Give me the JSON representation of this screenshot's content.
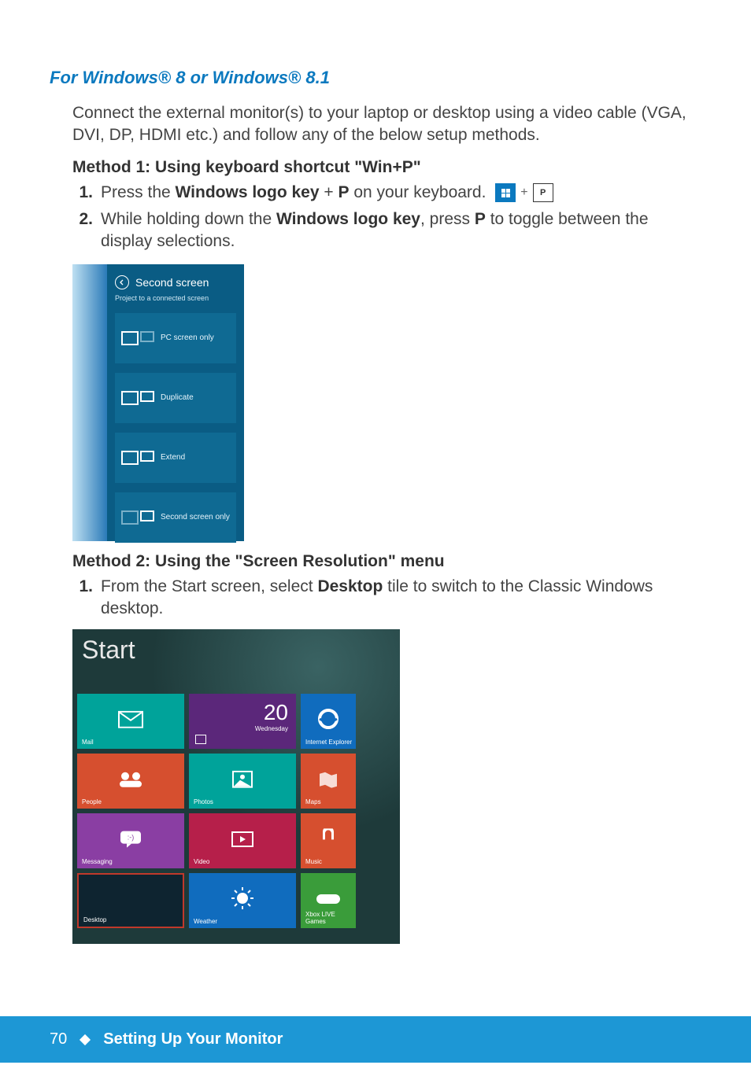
{
  "heading": "For Windows® 8 or Windows® 8.1",
  "intro": "Connect the external monitor(s) to your laptop or desktop using a video cable (VGA, DVI, DP, HDMI etc.) and follow any of the below setup methods.",
  "method1_title": "Method 1: Using keyboard shortcut \"Win+P\"",
  "step1_pre": "Press the ",
  "step1_bold1": "Windows logo key",
  "step1_mid": " + ",
  "step1_bold2": "P",
  "step1_post": " on your keyboard.",
  "step2_pre": "While holding down the ",
  "step2_bold1": "Windows logo key",
  "step2_mid": ", press ",
  "step2_bold2": "P",
  "step2_post": " to toggle between the display selections.",
  "charm": {
    "title": "Second screen",
    "subtitle": "Project to a connected screen",
    "options": [
      "PC screen only",
      "Duplicate",
      "Extend",
      "Second screen only"
    ]
  },
  "method2_title": "Method 2: Using the \"Screen Resolution\" menu",
  "m2_step1_pre": "From the Start screen, select ",
  "m2_step1_bold": "Desktop",
  "m2_step1_post": " tile to switch to the Classic Windows desktop.",
  "start": {
    "title": "Start",
    "tiles": {
      "mail": "Mail",
      "cal_num": "20",
      "cal_day": "Wednesday",
      "ie": "Internet Explorer",
      "people": "People",
      "photos": "Photos",
      "maps": "Maps",
      "messaging": "Messaging",
      "video": "Video",
      "music": "Music",
      "desktop": "Desktop",
      "weather": "Weather",
      "games": "Xbox LIVE Games"
    }
  },
  "footer": {
    "page": "70",
    "title": "Setting Up Your Monitor"
  },
  "keys": {
    "plus": "+",
    "p": "P"
  }
}
